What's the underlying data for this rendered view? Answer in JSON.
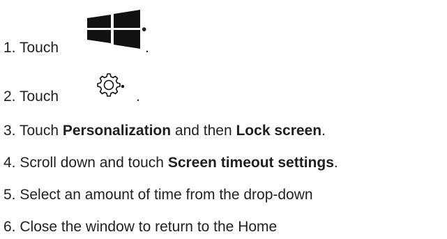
{
  "steps": [
    {
      "number": "1.",
      "text": "Touch",
      "suffix": "."
    },
    {
      "number": "2.",
      "text": "Touch",
      "suffix": "."
    },
    {
      "number": "3.",
      "text_before": "Touch ",
      "bold1": "Personalization",
      "text_middle": " and then ",
      "bold2": "Lock screen",
      "text_after": "."
    },
    {
      "number": "4.",
      "text_before": "Scroll down and touch ",
      "bold1": "Screen timeout settings",
      "text_after": "."
    },
    {
      "number": "5.",
      "text": "Select an amount of time from the drop-down"
    },
    {
      "number": "6.",
      "text": "Close the window to return to the Home"
    }
  ],
  "icons": {
    "step1": "windows-start-icon",
    "step2": "gear-settings-icon"
  },
  "colors": {
    "text": "#231f20",
    "icon": "#111111"
  }
}
